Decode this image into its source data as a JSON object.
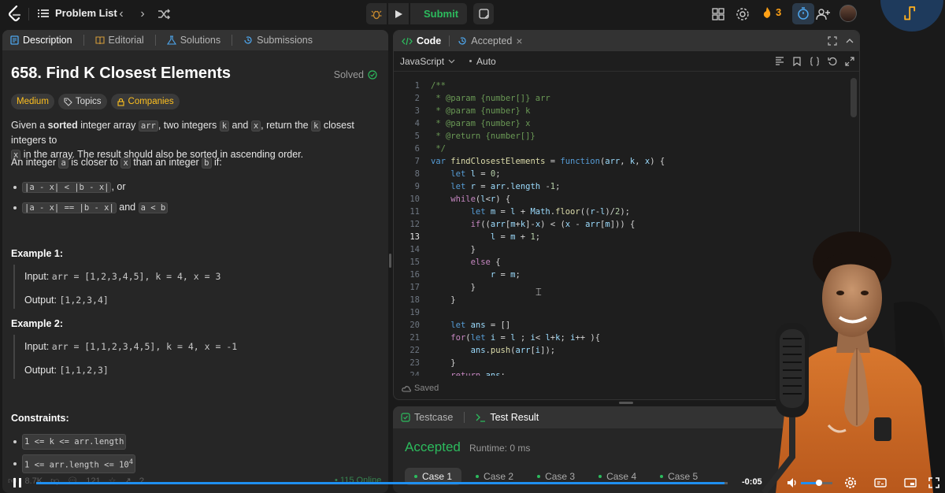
{
  "topbar": {
    "problem_list_label": "Problem List",
    "submit_label": "Submit",
    "streak_count": "3"
  },
  "description_panel": {
    "tabs": [
      {
        "label": "Description"
      },
      {
        "label": "Editorial"
      },
      {
        "label": "Solutions"
      },
      {
        "label": "Submissions"
      }
    ],
    "title": "658. Find K Closest Elements",
    "solved_label": "Solved",
    "chips": {
      "difficulty": "Medium",
      "topics": "Topics",
      "companies": "Companies"
    },
    "para1": {
      "t1": "Given a ",
      "bold": "sorted",
      "t2": " integer array ",
      "c1": "arr",
      "t3": ", two integers ",
      "c2": "k",
      "t4": " and ",
      "c3": "x",
      "t5": ", return the ",
      "c4": "k",
      "t6": " closest integers to",
      "c5": "x",
      "t7": " in the array. The result should also be sorted in ascending order."
    },
    "para2": {
      "t1": "An integer ",
      "c1": "a",
      "t2": " is closer to ",
      "c2": "x",
      "t3": " than an integer ",
      "c3": "b",
      "t4": " if:"
    },
    "bullets": {
      "b1_code": "|a - x| < |b - x|",
      "b1_text": ", or",
      "b2_code1": "|a - x| == |b - x|",
      "b2_text": " and ",
      "b2_code2": "a < b"
    },
    "example1": {
      "heading": "Example 1:",
      "input_label": "Input:",
      "input_value": "arr = [1,2,3,4,5], k = 4, x = 3",
      "output_label": "Output:",
      "output_value": "[1,2,3,4]"
    },
    "example2": {
      "heading": "Example 2:",
      "input_label": "Input:",
      "input_value": "arr = [1,1,2,3,4,5], k = 4, x = -1",
      "output_label": "Output:",
      "output_value": "[1,1,2,3]"
    },
    "constraints": {
      "heading": "Constraints:",
      "c1": "1 <= k <= arr.length",
      "c2": "1 <= arr.length <= 10",
      "c2_sup": "4"
    },
    "footer": {
      "likes": "8.7K",
      "comments": "121",
      "online": "115 Online"
    }
  },
  "code_panel": {
    "tabs": [
      {
        "label": "Code"
      },
      {
        "label": "Accepted"
      }
    ],
    "language": "JavaScript",
    "auto_label": "Auto",
    "saved_label": "Saved",
    "current_line": 13,
    "lines": [
      {
        "n": "1",
        "html": "<span class='cm'>/**</span>"
      },
      {
        "n": "2",
        "html": "<span class='cm'> * @param {number[]} arr</span>"
      },
      {
        "n": "3",
        "html": "<span class='cm'> * @param {number} k</span>"
      },
      {
        "n": "4",
        "html": "<span class='cm'> * @param {number} x</span>"
      },
      {
        "n": "5",
        "html": "<span class='cm'> * @return {number[]}</span>"
      },
      {
        "n": "6",
        "html": "<span class='cm'> */</span>"
      },
      {
        "n": "7",
        "html": "<span class='kw'>var</span> <span class='fn'>findClosestElements</span> = <span class='kw'>function</span>(<span class='vr'>arr</span>, <span class='vr'>k</span>, <span class='vr'>x</span>) {"
      },
      {
        "n": "8",
        "html": "    <span class='kw'>let</span> <span class='vr'>l</span> = <span class='num'>0</span>;"
      },
      {
        "n": "9",
        "html": "    <span class='kw'>let</span> <span class='vr'>r</span> = <span class='vr'>arr</span>.<span class='vr'>length</span> -<span class='num'>1</span>;"
      },
      {
        "n": "10",
        "html": "    <span class='kw2'>while</span>(<span class='vr'>l</span>&lt;<span class='vr'>r</span>) {"
      },
      {
        "n": "11",
        "html": "        <span class='kw'>let</span> <span class='vr'>m</span> = <span class='vr'>l</span> + <span class='vr'>Math</span>.<span class='fn'>floor</span>((<span class='vr'>r</span>-<span class='vr'>l</span>)/<span class='num'>2</span>);"
      },
      {
        "n": "12",
        "html": "        <span class='kw2'>if</span>((<span class='vr'>arr</span>[<span class='vr'>m</span>+<span class='vr'>k</span>]-<span class='vr'>x</span>) &lt; (<span class='vr'>x</span> - <span class='vr'>arr</span>[<span class='vr'>m</span>])) {"
      },
      {
        "n": "13",
        "html": "            <span class='vr'>l</span> = <span class='vr'>m</span> + <span class='num'>1</span>;"
      },
      {
        "n": "14",
        "html": "        }"
      },
      {
        "n": "15",
        "html": "        <span class='kw2'>else</span> {"
      },
      {
        "n": "16",
        "html": "            <span class='vr'>r</span> = <span class='vr'>m</span>;"
      },
      {
        "n": "17",
        "html": "        }"
      },
      {
        "n": "18",
        "html": "    }"
      },
      {
        "n": "19",
        "html": ""
      },
      {
        "n": "20",
        "html": "    <span class='kw'>let</span> <span class='vr'>ans</span> = []"
      },
      {
        "n": "21",
        "html": "    <span class='kw2'>for</span>(<span class='kw'>let</span> <span class='vr'>i</span> = <span class='vr'>l</span> ; <span class='vr'>i</span>&lt; <span class='vr'>l</span>+<span class='vr'>k</span>; <span class='vr'>i</span>++ ){"
      },
      {
        "n": "22",
        "html": "        <span class='vr'>ans</span>.<span class='fn'>push</span>(<span class='vr'>arr</span>[<span class='vr'>i</span>]);"
      },
      {
        "n": "23",
        "html": "    }"
      },
      {
        "n": "24",
        "html": "    <span class='kw2'>return</span> <span class='vr'>ans</span>;"
      }
    ]
  },
  "result_panel": {
    "tabs": [
      {
        "label": "Testcase"
      },
      {
        "label": "Test Result"
      }
    ],
    "status": "Accepted",
    "runtime": "Runtime: 0 ms",
    "cases": [
      "Case 1",
      "Case 2",
      "Case 3",
      "Case 4",
      "Case 5"
    ]
  },
  "video_controls": {
    "time_remaining": "-0:05",
    "progress": 0.995,
    "volume": 0.5
  },
  "colors": {
    "accent_green": "#2cbb5d",
    "accent_orange": "#ffa116",
    "medium_yellow": "#ffc01e",
    "progress_blue": "#1f8ff0"
  }
}
